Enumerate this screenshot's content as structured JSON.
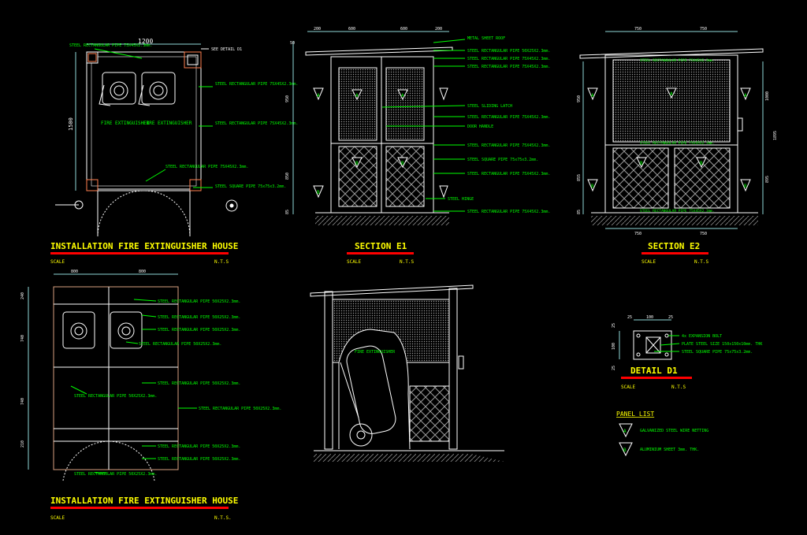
{
  "colors": {
    "background": "#000000",
    "line_white": "#ffffff",
    "label_green": "#00ff00",
    "title_yellow": "#ffff00",
    "underline_red": "#ff0000",
    "dim_cyan": "#8fd7d7",
    "hatch_gray": "#9a9a9a"
  },
  "plan_top": {
    "title": "INSTALLATION FIRE EXTINGUISHER HOUSE",
    "scale_label": "SCALE",
    "scale_value": "N.T.S",
    "dim_width": "1200",
    "dim_height": "1500",
    "see_detail": "SEE DETAIL D1",
    "extinguisher_1": "FIRE EXTINGUISHER",
    "extinguisher_2": "FIRE EXTINGUISHER",
    "callouts": [
      "STEEL RECTANGULAR PIPE 75X45X2.3mm.",
      "STEEL RECTANGULAR PIPE 75X45X2.3mm.",
      "STEEL RECTANGULAR PIPE 75X45X2.3mm.",
      "STEEL RECTANGULAR PIPE 75X45X2.3mm.",
      "STEEL SQUARE PIPE 75x75x3.2mm."
    ]
  },
  "plan_bottom": {
    "title": "INSTALLATION FIRE EXTINGUISHER HOUSE",
    "scale_label": "SCALE",
    "scale_value": "N.T.S.",
    "dims_top": [
      "800",
      "800"
    ],
    "dims_left": [
      "240",
      "740",
      "740",
      "210"
    ],
    "callouts": [
      "STEEL RECTANGULAR PIPE 50X25X2.3mm.",
      "STEEL RECTANGULAR PIPE 50X25X2.3mm.",
      "STEEL RECTANGULAR PIPE 50X25X2.3mm.",
      "STEEL RECTANGULAR PIPE 50X25X2.3mm.",
      "STEEL RECTANGULAR PIPE 50X25X2.3mm.",
      "STEEL RECTANGULAR PIPE 50X25X2.3mm.",
      "STEEL RECTANGULAR PIPE 50X25X2.3mm.",
      "STEEL RECTANGULAR PIPE 50X25X2.3mm.",
      "STEEL RECTANGULAR PIPE 50X25X2.3mm.",
      "STEEL RECTANGULAR PIPE 50X25X2.3mm."
    ]
  },
  "section_e1": {
    "title": "SECTION E1",
    "scale_label": "SCALE",
    "scale_value": "N.T.S",
    "dims_top": [
      "200",
      "600",
      "600",
      "200"
    ],
    "dims_left": [
      "50",
      "950",
      "850",
      "85"
    ],
    "panel_a": "A",
    "panel_b": "B",
    "callouts": [
      "METAL SHEET ROOF",
      "STEEL RECTANGULAR PIPE 50X25X2.3mm.",
      "STEEL RECTANGULAR PIPE 75X45X2.3mm.",
      "STEEL RECTANGULAR PIPE 75X45X2.3mm.",
      "STEEL SLIDING LATCH",
      "STEEL RECTANGULAR PIPE 75X45X2.3mm.",
      "DOOR HANDLE",
      "STEEL RECTANGULAR PIPE 75X45X2.3mm.",
      "STEEL SQUARE PIPE 75x75x3.2mm.",
      "STEEL RECTANGULAR PIPE 75X45X2.3mm.",
      "STEEL HINGE",
      "STEEL RECTANGULAR PIPE 75X45X2.3mm."
    ]
  },
  "section_e2": {
    "title": "SECTION E2",
    "scale_label": "SCALE",
    "scale_value": "N.T.S",
    "dims_top": [
      "750",
      "750"
    ],
    "dims_bottom": [
      "750",
      "750"
    ],
    "dims_left": [
      "950",
      "855",
      "85"
    ],
    "dims_right": [
      "1000",
      "1895",
      "895"
    ],
    "panel_a": "A",
    "panel_b": "B",
    "inner_labels": [
      "STEEL RECTANGULAR PIPE 75X45X2.3mm.",
      "STEEL RECTANGULAR PIPE 75X45X2.3mm.",
      "STEEL RECTANGULAR PIPE 75X45X2.3mm."
    ]
  },
  "side_view": {
    "label": "FIRE EXTINGUISHER"
  },
  "detail_d1": {
    "title": "DETAIL D1",
    "scale_label": "SCALE",
    "scale_value": "N.T.S",
    "dims_top": [
      "25",
      "100",
      "25"
    ],
    "dims_left": [
      "25",
      "100",
      "25"
    ],
    "callouts": [
      "4x EXPANSION BOLT",
      "PLATE STEEL SIZE 150x150x10mm. THK",
      "STEEL SQUARE PIPE 75x75x3.2mm."
    ]
  },
  "panel_list": {
    "title": "PANEL LIST",
    "items": [
      {
        "mark": "A",
        "text": "GALVANIZED STEEL WIRE NETTING"
      },
      {
        "mark": "B",
        "text": "ALUMINIUM SHEET 3mm. THK."
      }
    ]
  }
}
